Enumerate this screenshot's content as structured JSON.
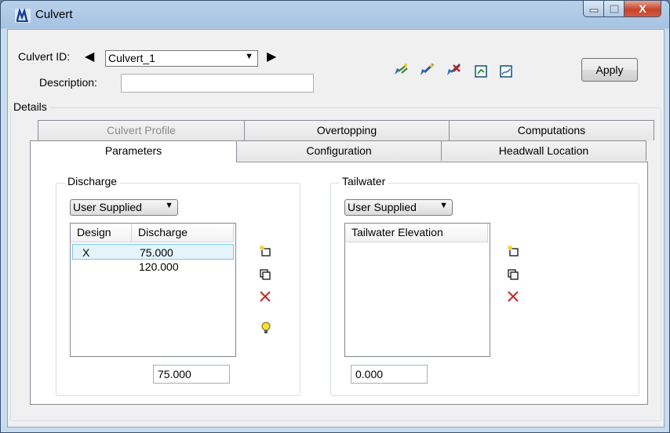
{
  "window": {
    "title": "Culvert",
    "min_label": "‒",
    "max_label": "☐",
    "close_label": "X"
  },
  "header": {
    "culvert_id_label": "Culvert ID:",
    "culvert_id_value": "Culvert_1",
    "description_label": "Description:",
    "description_value": "",
    "apply_label": "Apply",
    "toolbar_icons": [
      "add-culvert-icon",
      "edit-culvert-icon",
      "delete-culvert-icon",
      "report-icon",
      "graph-icon"
    ]
  },
  "details": {
    "label": "Details",
    "tabs_back": [
      "Culvert Profile",
      "Overtopping",
      "Computations"
    ],
    "tabs_front": [
      "Parameters",
      "Configuration",
      "Headwall Location"
    ],
    "active_tab": "Parameters"
  },
  "discharge": {
    "title": "Discharge",
    "mode": "User Supplied",
    "columns": [
      "Design",
      "Discharge"
    ],
    "rows": [
      {
        "design": "X",
        "discharge": "75.000",
        "selected": true
      },
      {
        "design": "",
        "discharge": "120.000",
        "selected": false
      }
    ],
    "value": "75.000",
    "side_icons": [
      "add-row-icon",
      "copy-row-icon",
      "delete-row-icon",
      "hint-bulb-icon"
    ]
  },
  "tailwater": {
    "title": "Tailwater",
    "mode": "User Supplied",
    "columns": [
      "Tailwater Elevation"
    ],
    "rows": [],
    "value": "0.000",
    "side_icons": [
      "add-row-icon",
      "copy-row-icon",
      "delete-row-icon"
    ]
  },
  "colors": {
    "accent_border": "#7dc4ec",
    "selection": "#e5f3fb",
    "close_red": "#c7432b"
  }
}
